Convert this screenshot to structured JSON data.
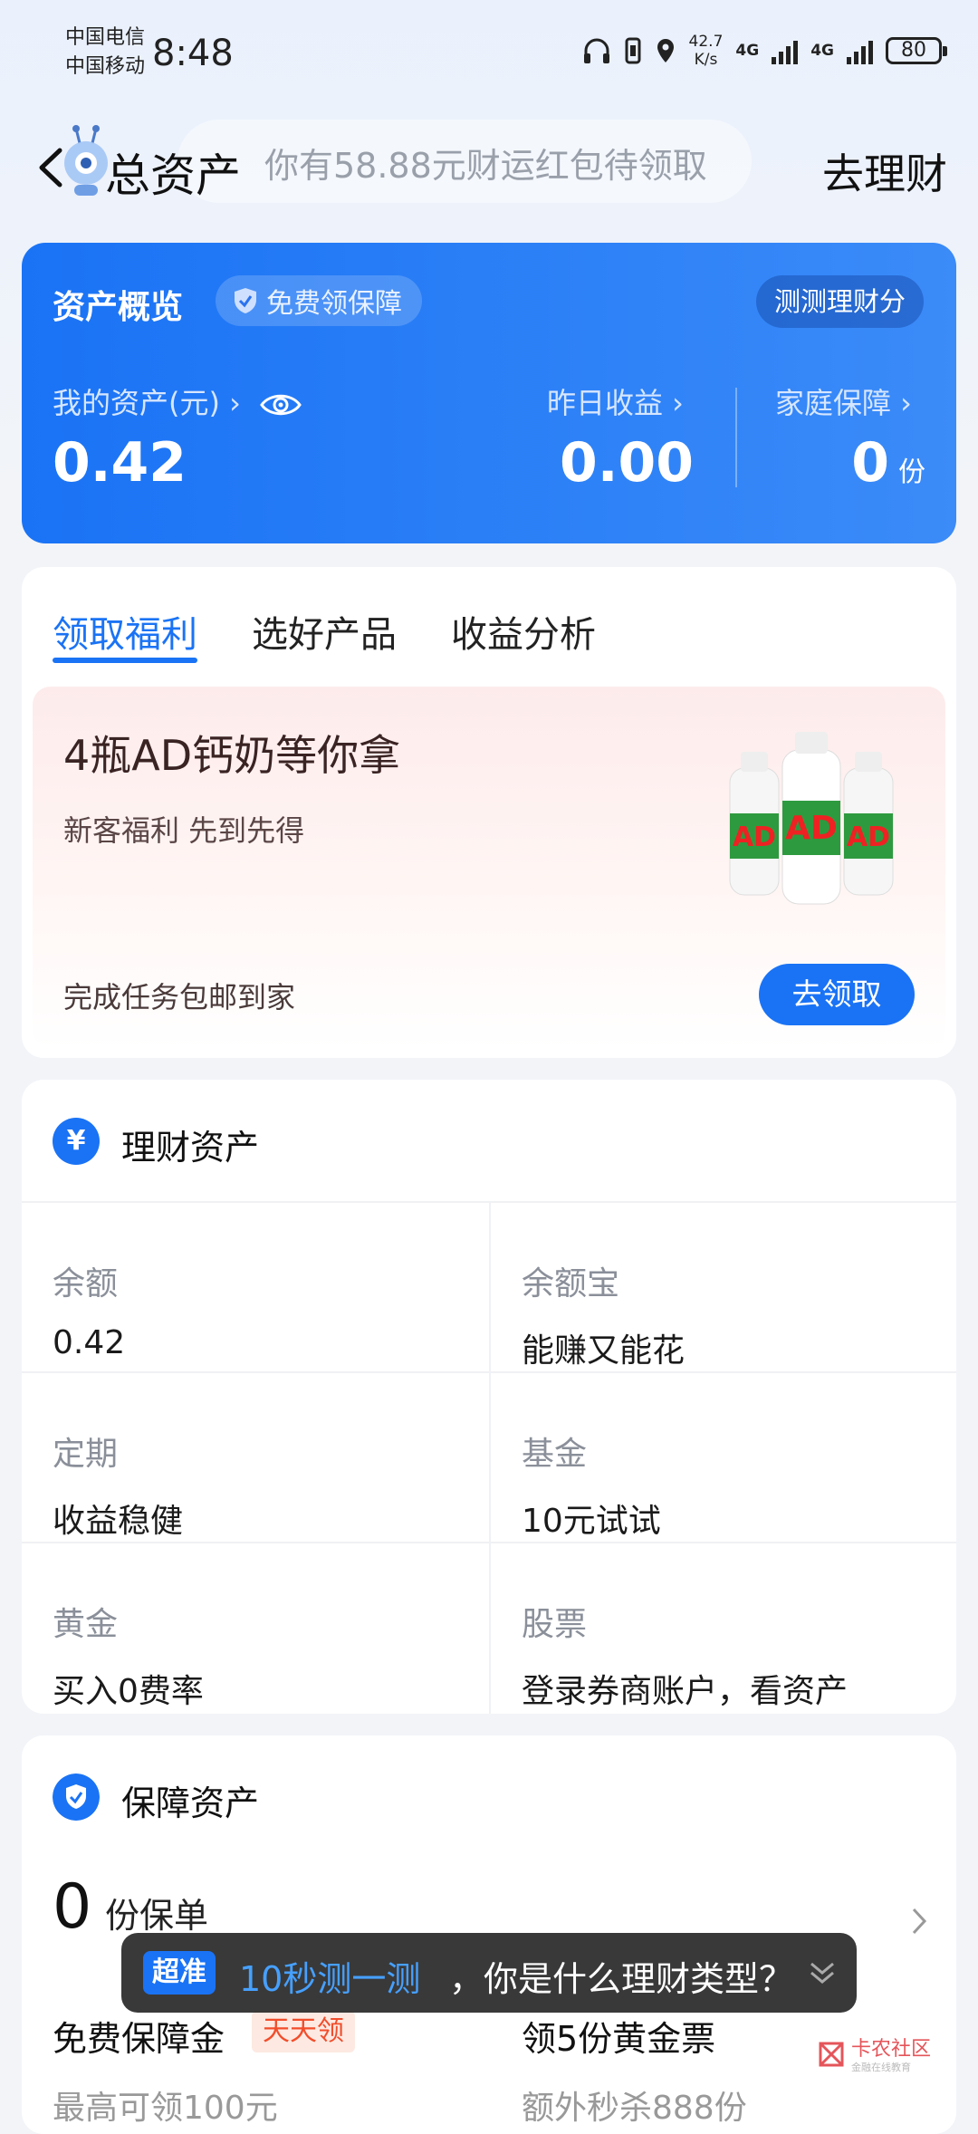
{
  "status_bar": {
    "carrier_1": "中国电信",
    "carrier_2": "中国移动",
    "time": "8:48",
    "net_speed": "42.7",
    "net_speed_unit": "K/s",
    "network_1": "4G",
    "network_2": "4G",
    "battery": "80"
  },
  "header": {
    "title": "总资产",
    "promo": "你有58.88元财运红包待领取",
    "right_action": "去理财"
  },
  "overview": {
    "title": "资产概览",
    "badge": "免费领保障",
    "test_button": "测测理财分",
    "my_assets_label": "我的资产(元) ›",
    "my_assets_value": "0.42",
    "yesterday_label": "昨日收益 ›",
    "yesterday_value": "0.00",
    "family_label": "家庭保障 ›",
    "family_value": "0",
    "family_unit": "份"
  },
  "benefits": {
    "tabs": [
      "领取福利",
      "选好产品",
      "收益分析"
    ],
    "promo_title": "4瓶AD钙奶等你拿",
    "promo_sub": "新客福利 先到先得",
    "promo_footer": "完成任务包邮到家",
    "claim_button": "去领取",
    "product_image": "ad-calcium-milk-bottles"
  },
  "wealth": {
    "title": "理财资产",
    "icon": "¥",
    "cells": [
      {
        "label": "余额",
        "value": "0.42"
      },
      {
        "label": "余额宝",
        "value": "能赚又能花"
      },
      {
        "label": "定期",
        "value": "收益稳健"
      },
      {
        "label": "基金",
        "value": "10元试试"
      },
      {
        "label": "黄金",
        "value": "买入0费率"
      },
      {
        "label": "股票",
        "value": "登录券商账户，看资产"
      }
    ]
  },
  "insurance": {
    "title": "保障资产",
    "count": "0",
    "count_unit": "份保单",
    "item_1_title": "免费保障金",
    "item_1_tag": "天天领",
    "item_1_sub": "最高可领100元",
    "item_2_title": "领5份黄金票",
    "item_2_sub": "额外秒杀888份"
  },
  "quiz_toast": {
    "badge": "超准",
    "highlight": "10秒测一测",
    "rest": "，你是什么理财类型？"
  },
  "watermark": {
    "text": "卡农社区",
    "sub": "金融在线教育"
  },
  "colors": {
    "accent": "#1a73f5",
    "page_bg": "#f2f4f8",
    "tag_red": "#f24d2b"
  }
}
